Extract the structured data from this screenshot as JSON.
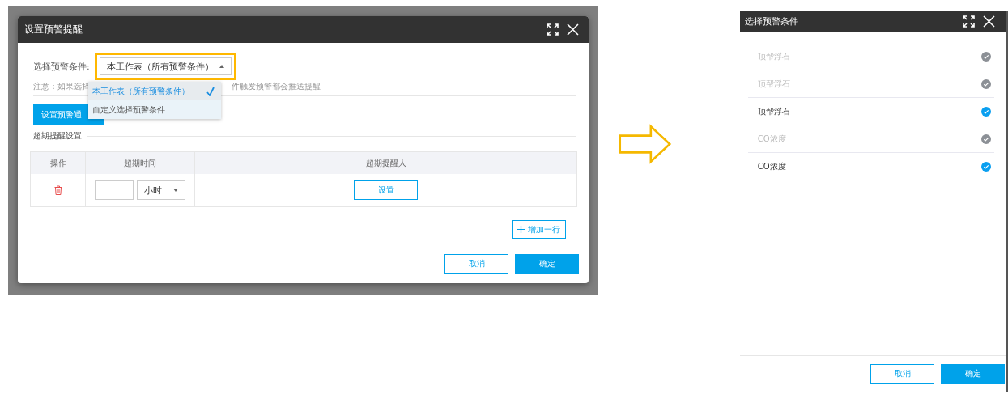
{
  "left_dialog": {
    "title": "设置预警提醒",
    "condition_label": "选择预警条件:",
    "condition_value": "本工作表（所有预警条件）",
    "highlighted": true,
    "dropdown": [
      {
        "label": "本工作表（所有预警条件）",
        "selected": true
      },
      {
        "label": "自定义选择预警条件",
        "selected": false
      }
    ],
    "note_parts": [
      "注意：如果选择",
      "件触发预警都会推送提醒"
    ],
    "notify_button": "设置预警通",
    "section_title": "超期提醒设置",
    "table": {
      "columns": [
        "操作",
        "超期时间",
        "超期提醒人"
      ],
      "rows": [
        {
          "unit": "小时",
          "assign_button": "设置"
        }
      ]
    },
    "add_row_button": "增加一行",
    "buttons": [
      "取消",
      "确定"
    ]
  },
  "right_dialog": {
    "title": "选择预警条件",
    "items": [
      {
        "label": "顶帮浮石",
        "selected": false,
        "disabled": true
      },
      {
        "label": "顶帮浮石",
        "selected": false,
        "disabled": true
      },
      {
        "label": "顶帮浮石",
        "selected": true,
        "disabled": false
      },
      {
        "label": "CO浓度",
        "selected": false,
        "disabled": true
      },
      {
        "label": "CO浓度",
        "selected": true,
        "disabled": false
      }
    ],
    "buttons": [
      "取消",
      "确定"
    ]
  }
}
